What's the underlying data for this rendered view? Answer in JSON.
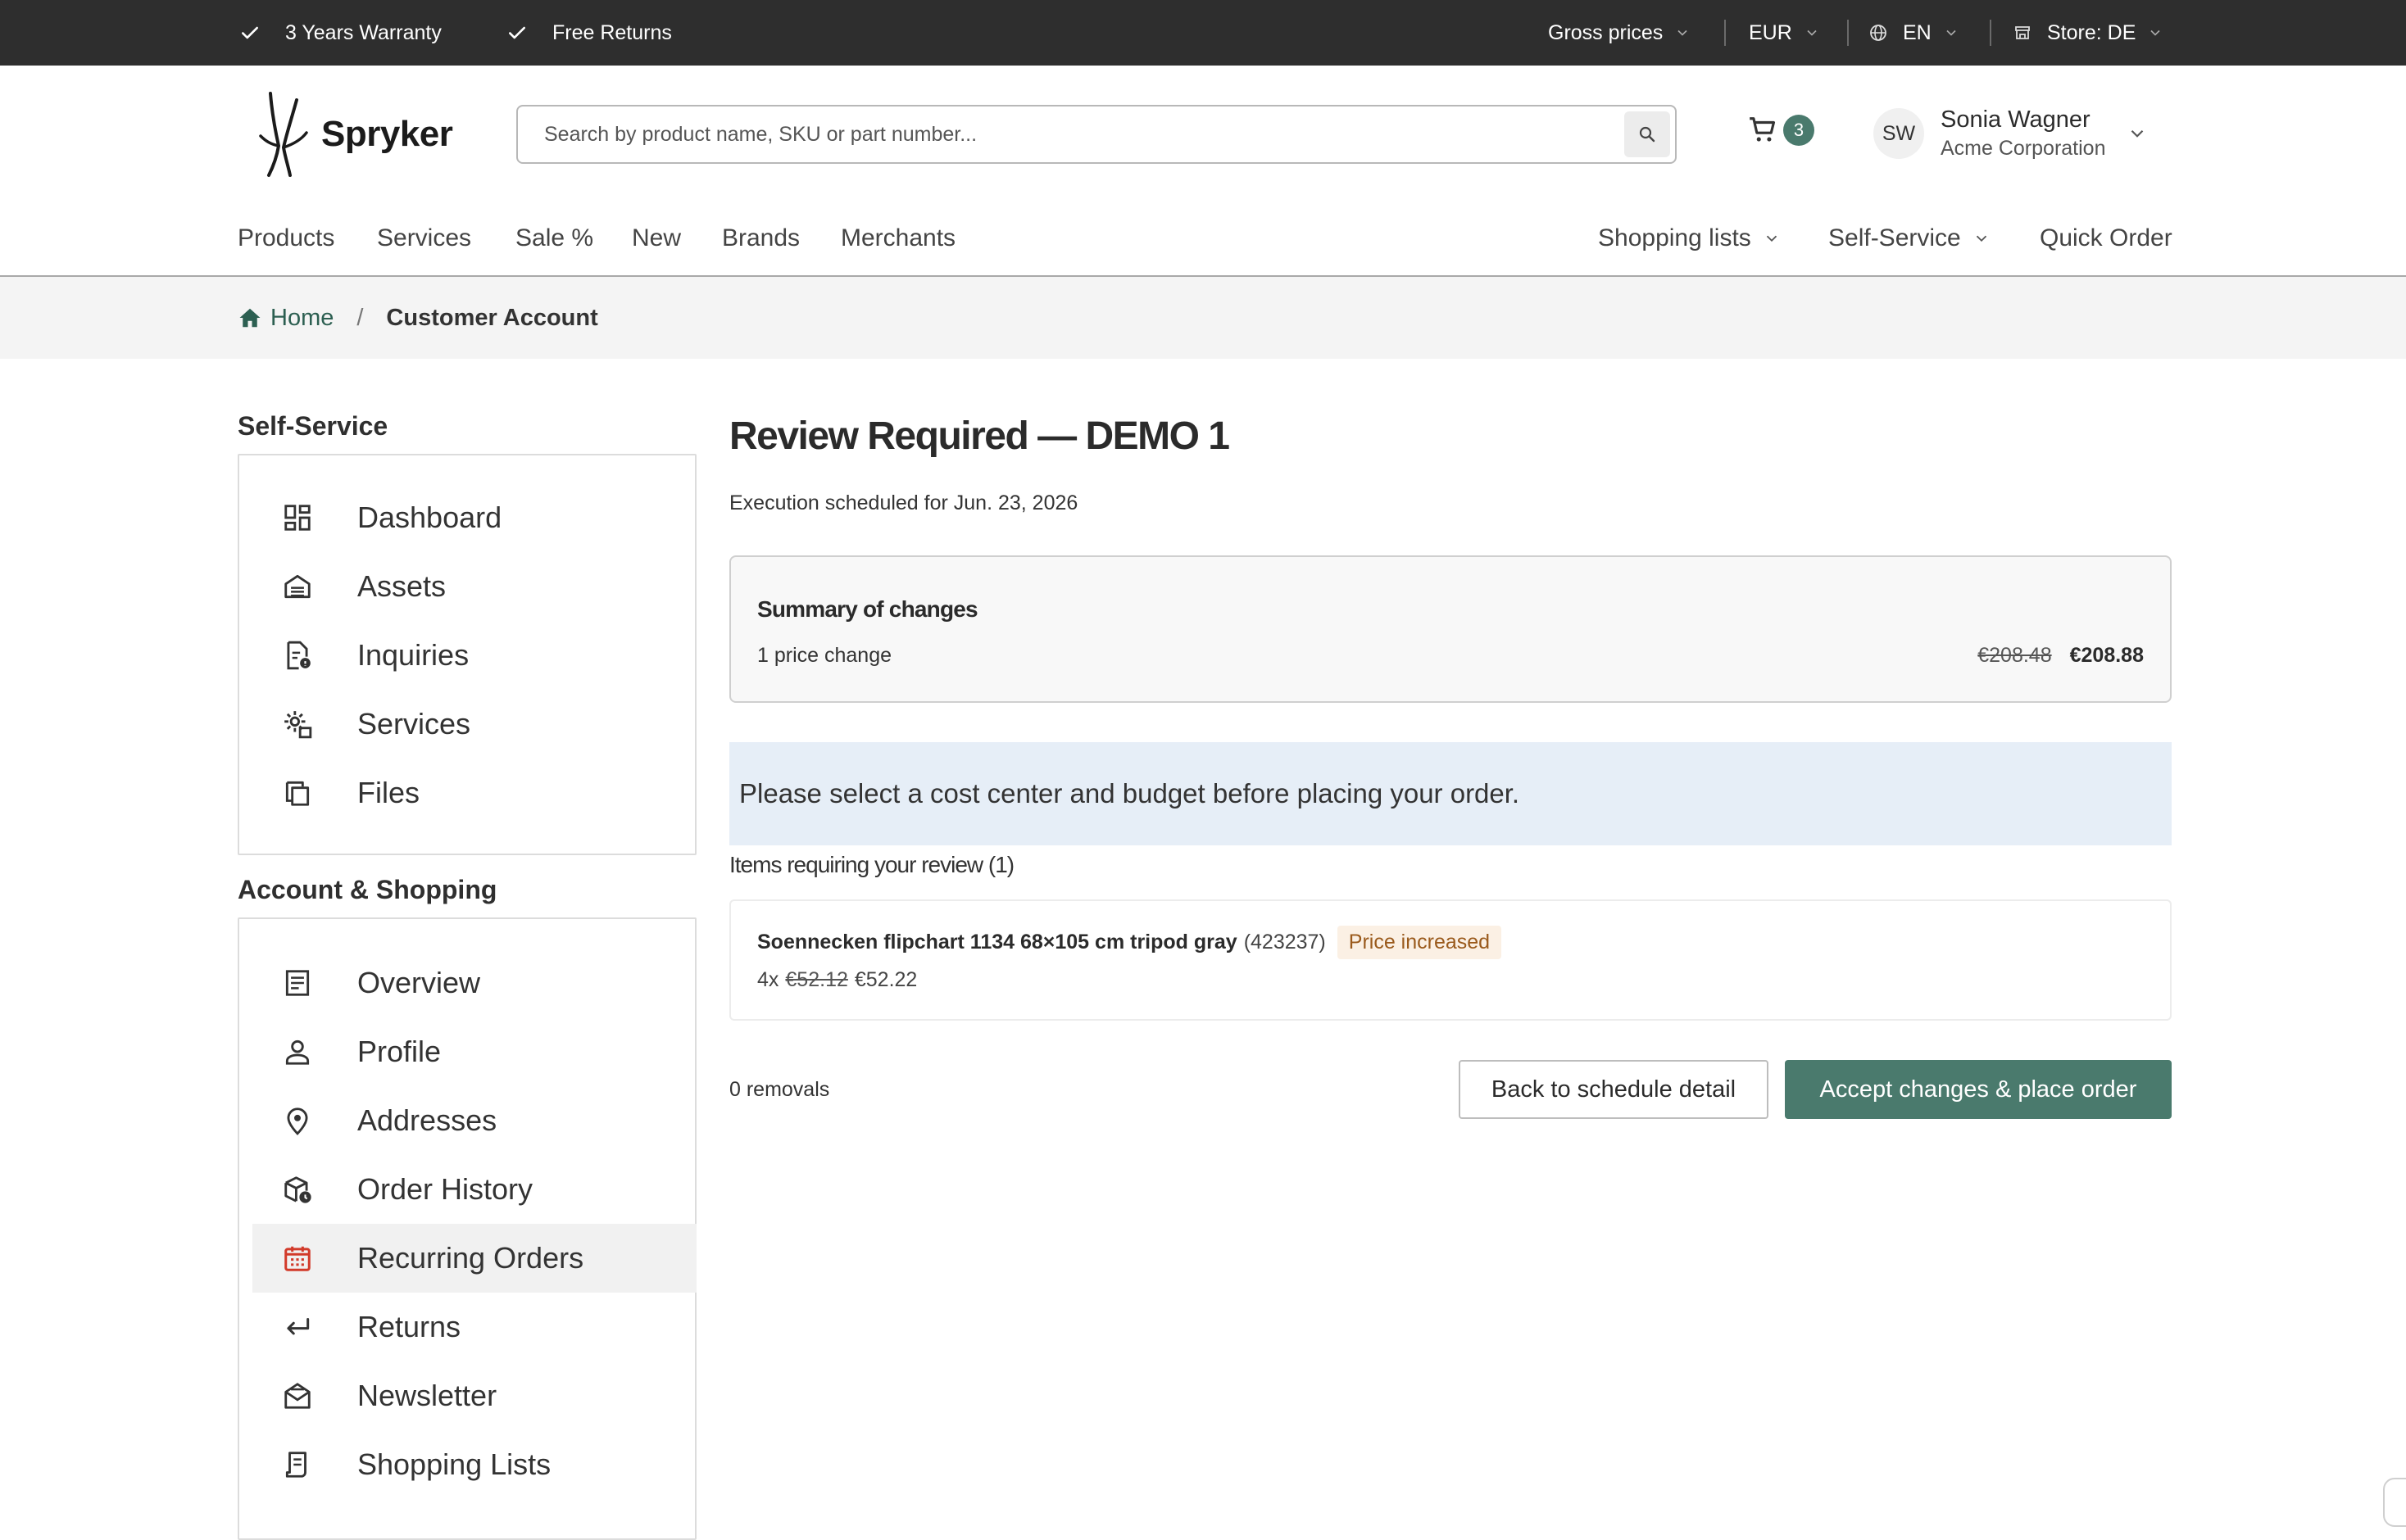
{
  "topbar": {
    "usps": [
      "3 Years Warranty",
      "Free Returns"
    ],
    "price_mode": "Gross prices",
    "currency": "EUR",
    "language": "EN",
    "store": "Store: DE"
  },
  "header": {
    "logo_text": "Spryker",
    "search_placeholder": "Search by product name, SKU or part number...",
    "cart_count": "3",
    "user": {
      "initials": "SW",
      "name": "Sonia Wagner",
      "company": "Acme Corporation"
    }
  },
  "nav": {
    "left": [
      "Products",
      "Services",
      "Sale %",
      "New",
      "Brands",
      "Merchants"
    ],
    "right": [
      "Shopping lists",
      "Self-Service",
      "Quick Order"
    ]
  },
  "breadcrumb": {
    "home": "Home",
    "separator": "/",
    "current": "Customer Account"
  },
  "sidebar": {
    "self_service": {
      "title": "Self-Service",
      "items": [
        {
          "label": "Dashboard",
          "icon": "dashboard-icon"
        },
        {
          "label": "Assets",
          "icon": "assets-icon"
        },
        {
          "label": "Inquiries",
          "icon": "inquiries-icon"
        },
        {
          "label": "Services",
          "icon": "services-icon"
        },
        {
          "label": "Files",
          "icon": "files-icon"
        }
      ]
    },
    "account": {
      "title": "Account & Shopping",
      "items": [
        {
          "label": "Overview",
          "icon": "overview-icon"
        },
        {
          "label": "Profile",
          "icon": "profile-icon"
        },
        {
          "label": "Addresses",
          "icon": "location-pin-icon"
        },
        {
          "label": "Order History",
          "icon": "order-history-icon"
        },
        {
          "label": "Recurring Orders",
          "icon": "calendar-icon",
          "active": true
        },
        {
          "label": "Returns",
          "icon": "return-arrow-icon"
        },
        {
          "label": "Newsletter",
          "icon": "newsletter-icon"
        },
        {
          "label": "Shopping Lists",
          "icon": "shopping-list-icon"
        }
      ]
    }
  },
  "content": {
    "title": "Review Required — DEMO 1",
    "execution": "Execution scheduled for Jun. 23, 2026",
    "summary": {
      "title": "Summary of changes",
      "count": "1 price change",
      "old_total": "€208.48",
      "new_total": "€208.88"
    },
    "notice": "Please select a cost center and budget before placing your order.",
    "items_heading": "Items requiring your review (1)",
    "items": [
      {
        "name": "Soennecken flipchart 1134 68×105 cm tripod gray",
        "sku": "(423237)",
        "badge": "Price increased",
        "qty": "4x",
        "old_price": "€52.12",
        "new_price": "€52.22"
      }
    ],
    "removals": "0 removals",
    "back_button": "Back to schedule detail",
    "accept_button": "Accept changes & place order"
  },
  "colors": {
    "topbar_bg": "#2e2e2e",
    "brand_green": "#4a7a6d",
    "notice_bg": "#e6eef7",
    "active_icon": "#d23a2a",
    "badge_bg": "#fbf0e4"
  }
}
